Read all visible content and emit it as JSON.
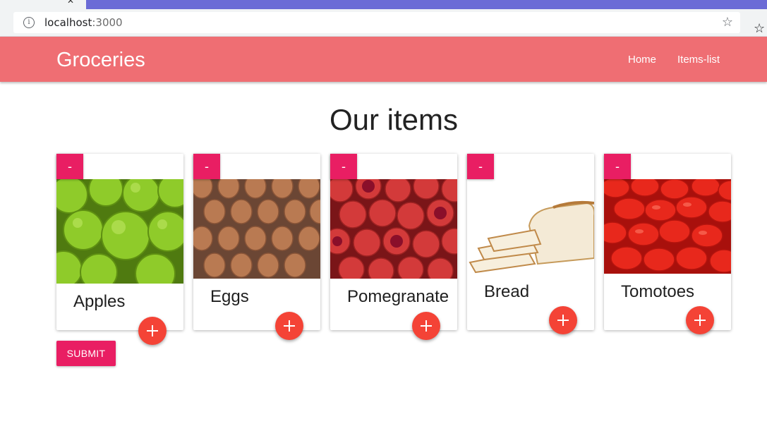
{
  "browser": {
    "url_host": "localhost",
    "url_port": ":3000"
  },
  "appbar": {
    "brand": "Groceries",
    "nav": [
      "Home",
      "Items-list"
    ],
    "color": "#ef6e73"
  },
  "page": {
    "title": "Our items"
  },
  "items": [
    {
      "name": "Apples",
      "minus_label": "-",
      "image": "green-apples"
    },
    {
      "name": "Eggs",
      "minus_label": "-",
      "image": "eggs-tray"
    },
    {
      "name": "Pomegranate",
      "minus_label": "-",
      "image": "pomegranates"
    },
    {
      "name": "Bread",
      "minus_label": "-",
      "image": "sliced-bread"
    },
    {
      "name": "Tomotoes",
      "minus_label": "-",
      "image": "tomatoes"
    }
  ],
  "submit_label": "SUBMIT",
  "colors": {
    "accent": "#e91e63",
    "fab": "#f44336"
  }
}
